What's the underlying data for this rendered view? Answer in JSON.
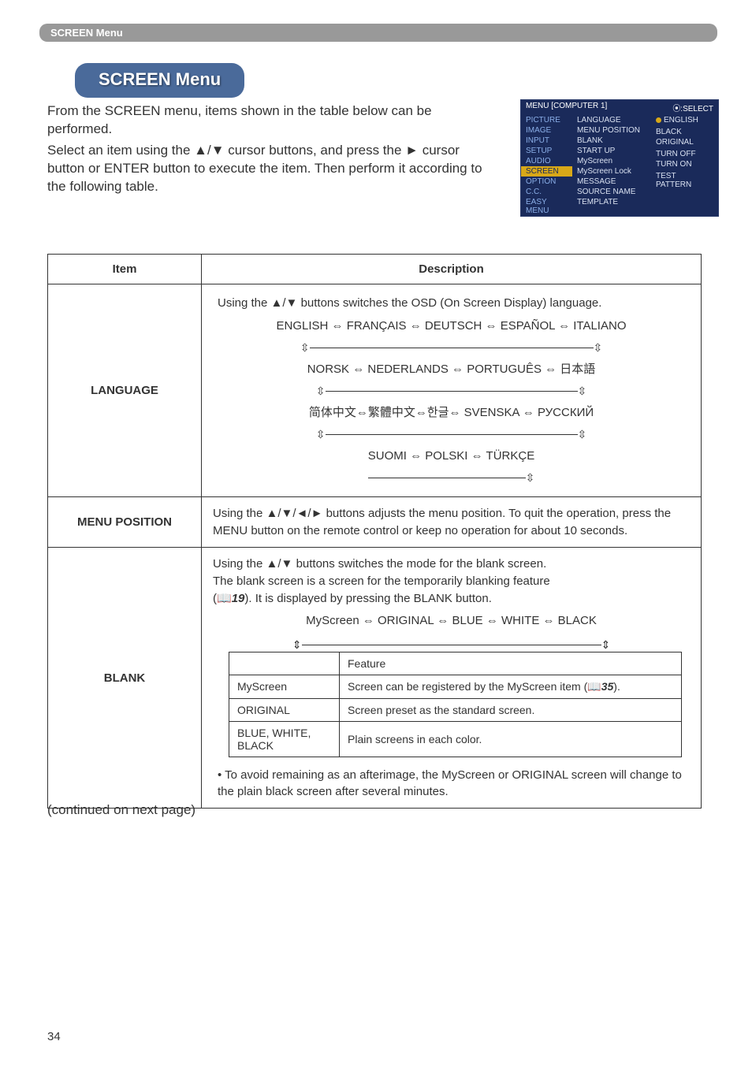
{
  "breadcrumb": "SCREEN Menu",
  "title": "SCREEN Menu",
  "intro": {
    "p1": "From the SCREEN menu, items shown in the table below can be performed.",
    "p2": "Select an item using the ▲/▼ cursor buttons, and press the ► cursor button or ENTER button to execute the item. Then perform it according to the following table."
  },
  "osd": {
    "header_left": "MENU [COMPUTER 1]",
    "header_right": "⦿:SELECT",
    "left": [
      "PICTURE",
      "IMAGE",
      "INPUT",
      "SETUP",
      "AUDIO",
      "SCREEN",
      "OPTION",
      "C.C.",
      "EASY MENU"
    ],
    "mid": [
      "LANGUAGE",
      "MENU POSITION",
      "BLANK",
      "START UP",
      "MyScreen",
      "MyScreen Lock",
      "MESSAGE",
      "SOURCE NAME",
      "TEMPLATE"
    ],
    "right": [
      "ENGLISH",
      "",
      "BLACK",
      "ORIGINAL",
      "",
      "TURN OFF",
      "TURN ON",
      "",
      "TEST PATTERN"
    ]
  },
  "table": {
    "head_item": "Item",
    "head_desc": "Description",
    "language": {
      "label": "LANGUAGE",
      "line1": "Using the ▲/▼ buttons switches the OSD (On Screen Display) language.",
      "row1": "ENGLISH ⇔ FRANÇAIS ⇔ DEUTSCH ⇔ ESPAÑOL ⇔ ITALIANO",
      "row2": "NORSK ⇔ NEDERLANDS ⇔ PORTUGUÊS ⇔ 日本語",
      "row3": "简体中文⇔繁體中文⇔한글⇔ SVENSKA ⇔ РУССКИЙ",
      "row4": "SUOMI ⇔ POLSKI ⇔ TÜRKÇE"
    },
    "menu_position": {
      "label": "MENU POSITION",
      "body": "Using the ▲/▼/◄/► buttons adjusts the menu position.\nTo quit the operation, press the MENU button on the remote control or keep no operation for about 10 seconds."
    },
    "blank": {
      "label": "BLANK",
      "top1": "Using the ▲/▼ buttons switches the mode for the blank screen.",
      "top2": "The blank screen is a screen for the temporarily blanking feature",
      "top3a": "(",
      "top3_ref": "19",
      "top3b": ").  It is displayed by pressing the BLANK button.",
      "cycle": "MyScreen ⇔ ORIGINAL ⇔ BLUE ⇔ WHITE ⇔ BLACK",
      "inner": {
        "h_blank": "",
        "h_feature": "Feature",
        "r1c1": "MyScreen",
        "r1c2a": "Screen can be registered by the MyScreen item (",
        "r1c2_ref": "35",
        "r1c2b": ").",
        "r2c1": "ORIGINAL",
        "r2c2": "Screen preset as the standard screen.",
        "r3c1": "BLUE, WHITE, BLACK",
        "r3c2": "Plain screens in each color."
      },
      "note": "• To avoid remaining as an afterimage, the MyScreen or ORIGINAL screen will change to the plain black screen after several minutes."
    }
  },
  "continued": "(continued on next page)",
  "page": "34"
}
